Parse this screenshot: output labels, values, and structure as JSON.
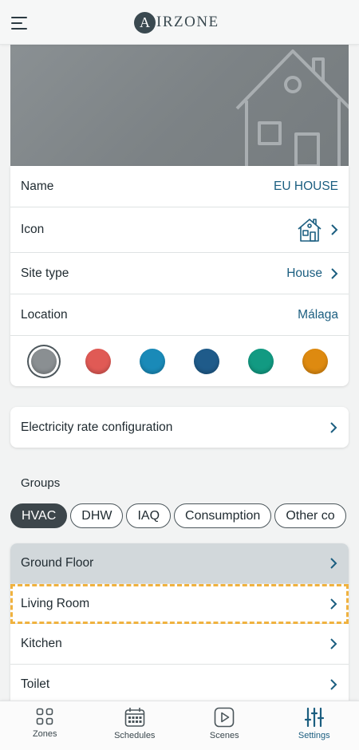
{
  "app": {
    "logo_letter": "A",
    "logo_text": "IRZONE"
  },
  "site": {
    "name_label": "Name",
    "name_value": "EU HOUSE",
    "icon_label": "Icon",
    "icon_value": "house-icon",
    "type_label": "Site type",
    "type_value": "House",
    "location_label": "Location",
    "location_value": "Málaga"
  },
  "colors": [
    "#8a8f92",
    "#e05a55",
    "#1a8ab8",
    "#1f5b8a",
    "#129a82",
    "#de8a10"
  ],
  "selected_color_index": 0,
  "electricity": {
    "label": "Electricity rate configuration"
  },
  "groups": {
    "title": "Groups",
    "chips": [
      "HVAC",
      "DHW",
      "IAQ",
      "Consumption",
      "Other co"
    ],
    "active_chip": "HVAC",
    "rows": [
      {
        "label": "Ground Floor"
      },
      {
        "label": "Living Room"
      },
      {
        "label": "Kitchen"
      },
      {
        "label": "Toilet"
      }
    ]
  },
  "nav": {
    "zones": "Zones",
    "schedules": "Schedules",
    "scenes": "Scenes",
    "settings": "Settings",
    "active": "Settings"
  }
}
